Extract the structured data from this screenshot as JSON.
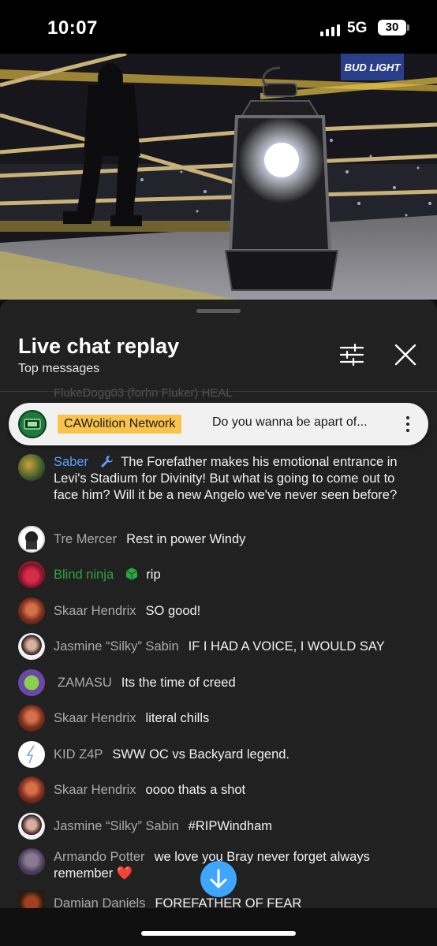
{
  "status_bar": {
    "time": "10:07",
    "network": "5G",
    "battery": "30"
  },
  "video": {
    "billboard_text": "BUD LIGHT"
  },
  "chat": {
    "title": "Live chat replay",
    "subtitle": "Top messages",
    "ghost_row": "FlukeDogg03 (forhn Fluker)  HEAL",
    "pinned": {
      "author": "CAWolition Network",
      "text": "Do you wanna be apart of..."
    },
    "messages": [
      {
        "author": "Saber",
        "author_color": "#5e9dff",
        "text": "The Forefather makes his emotional entrance in Levi's Stadium for Divinity! But what is going to come out to face him? Will it be a new Angelo we've never seen before?",
        "icon": "wrench-icon"
      },
      {
        "author": "Tre Mercer",
        "text": "Rest in power Windy"
      },
      {
        "author": "Blind ninja",
        "author_color": "#2ba640",
        "text": "rip",
        "icon": "cube-icon"
      },
      {
        "author": "Skaar Hendrix",
        "text": "SO good!"
      },
      {
        "author": "Jasmine “Silky” Sabin",
        "text": "IF I HAD A VOICE, I WOULD SAY"
      },
      {
        "author": "ZAMASU",
        "text": "Its the time of creed"
      },
      {
        "author": "Skaar Hendrix",
        "text": "literal chills"
      },
      {
        "author": "KID Z4P",
        "text": "SWW OC vs Backyard legend."
      },
      {
        "author": "Skaar Hendrix",
        "text": "oooo thats a shot"
      },
      {
        "author": "Jasmine “Silky” Sabin",
        "text": "#RIPWindham"
      },
      {
        "author": "Armando Potter",
        "text": "we love you Bray never forget always remember ❤️"
      },
      {
        "author": "Damian Daniels",
        "text": "FOREFATHER OF FEAR"
      }
    ]
  }
}
